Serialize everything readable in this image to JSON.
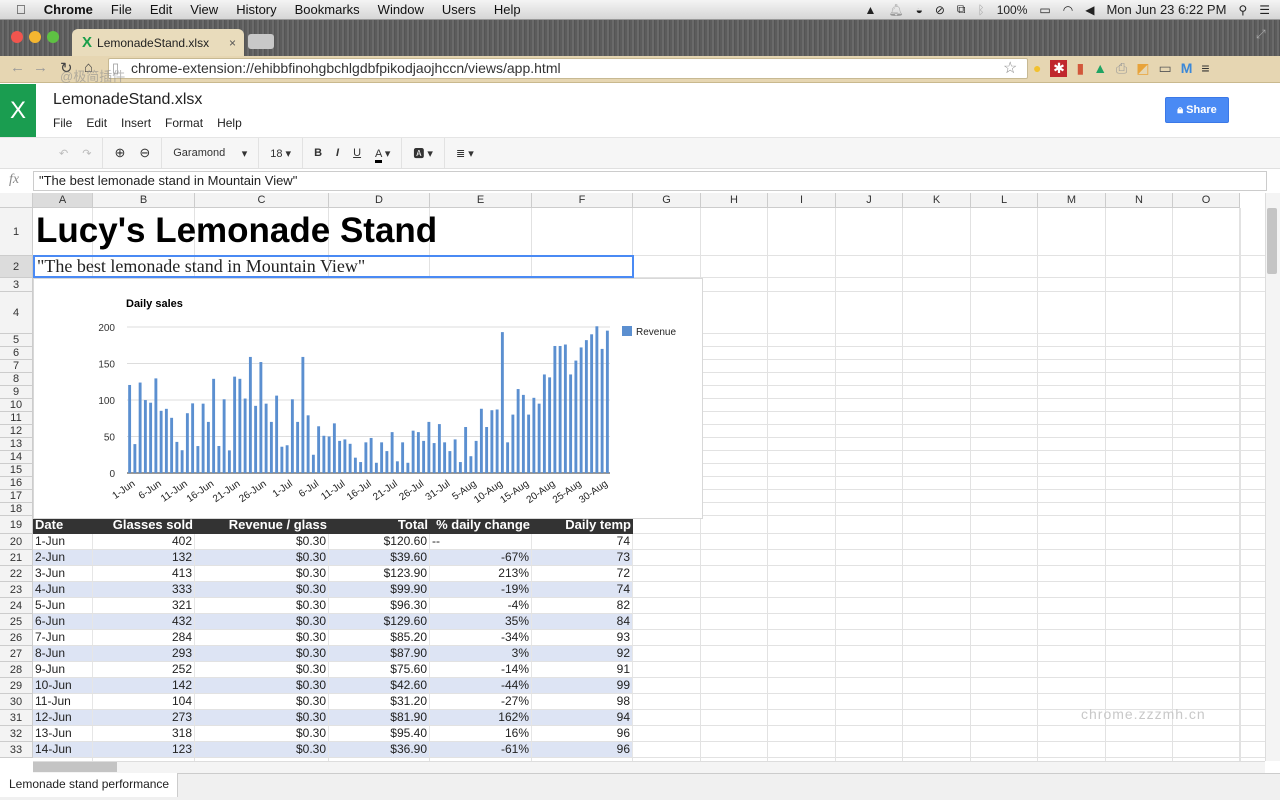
{
  "os_menubar": {
    "app": "Chrome",
    "items": [
      "File",
      "Edit",
      "View",
      "History",
      "Bookmarks",
      "Window",
      "Users",
      "Help"
    ],
    "battery": "100%",
    "clock": "Mon Jun 23  6:22 PM"
  },
  "browser": {
    "tab_title": "LemonadeStand.xlsx",
    "url": "chrome-extension://ehibbfinohgbchlgdbfpikodjaojhccn/views/app.html",
    "watermark_overlay": "@极简插件"
  },
  "app": {
    "logo": "X",
    "doc_title": "LemonadeStand.xlsx",
    "menu": [
      "File",
      "Edit",
      "Insert",
      "Format",
      "Help"
    ],
    "share_label": "Share",
    "toolbar": {
      "font": "Garamond",
      "size": "18",
      "bold": "B",
      "italic": "I",
      "underline": "U",
      "text_color": "A"
    },
    "formula_icon": "fx",
    "formula_value": "\"The best lemonade stand in Mountain View\""
  },
  "sheet": {
    "columns": [
      "A",
      "B",
      "C",
      "D",
      "E",
      "F",
      "G",
      "H",
      "I",
      "J",
      "K",
      "L",
      "M",
      "N",
      "O"
    ],
    "title": "Lucy's Lemonade Stand",
    "subtitle": "\"The best lemonade stand in Mountain View\"",
    "table_headers": [
      "Date",
      "Glasses sold",
      "Revenue / glass",
      "Total",
      "% daily change",
      "Daily temp"
    ],
    "table_rows": [
      [
        "1-Jun",
        "402",
        "$0.30",
        "$120.60",
        "--",
        "74"
      ],
      [
        "2-Jun",
        "132",
        "$0.30",
        "$39.60",
        "-67%",
        "73"
      ],
      [
        "3-Jun",
        "413",
        "$0.30",
        "$123.90",
        "213%",
        "72"
      ],
      [
        "4-Jun",
        "333",
        "$0.30",
        "$99.90",
        "-19%",
        "74"
      ],
      [
        "5-Jun",
        "321",
        "$0.30",
        "$96.30",
        "-4%",
        "82"
      ],
      [
        "6-Jun",
        "432",
        "$0.30",
        "$129.60",
        "35%",
        "84"
      ],
      [
        "7-Jun",
        "284",
        "$0.30",
        "$85.20",
        "-34%",
        "93"
      ],
      [
        "8-Jun",
        "293",
        "$0.30",
        "$87.90",
        "3%",
        "92"
      ],
      [
        "9-Jun",
        "252",
        "$0.30",
        "$75.60",
        "-14%",
        "91"
      ],
      [
        "10-Jun",
        "142",
        "$0.30",
        "$42.60",
        "-44%",
        "99"
      ],
      [
        "11-Jun",
        "104",
        "$0.30",
        "$31.20",
        "-27%",
        "98"
      ],
      [
        "12-Jun",
        "273",
        "$0.30",
        "$81.90",
        "162%",
        "94"
      ],
      [
        "13-Jun",
        "318",
        "$0.30",
        "$95.40",
        "16%",
        "96"
      ],
      [
        "14-Jun",
        "123",
        "$0.30",
        "$36.90",
        "-61%",
        "96"
      ]
    ],
    "sheet_tab": "Lemonade stand performance",
    "header_color": "#333333",
    "band_color": "#dde4f4"
  },
  "watermark": "chrome.zzzmh.cn",
  "chart_data": {
    "type": "bar",
    "title": "Daily sales",
    "legend": "Revenue",
    "legend_position": "right",
    "color": "#5b8fd0",
    "ylim": [
      0,
      200
    ],
    "yticks": [
      0,
      50,
      100,
      150,
      200
    ],
    "grid": true,
    "start_date": "1-Jun",
    "xtick_labels": [
      "1-Jun",
      "6-Jun",
      "11-Jun",
      "16-Jun",
      "21-Jun",
      "26-Jun",
      "1-Jul",
      "6-Jul",
      "11-Jul",
      "16-Jul",
      "21-Jul",
      "26-Jul",
      "31-Jul",
      "5-Aug",
      "10-Aug",
      "15-Aug",
      "20-Aug",
      "25-Aug",
      "30-Aug"
    ],
    "values": [
      120.6,
      39.6,
      123.9,
      99.9,
      96.3,
      129.6,
      85.2,
      87.9,
      75.6,
      42.6,
      31.2,
      81.9,
      95.4,
      36.9,
      95,
      70,
      129,
      37,
      101,
      31,
      132,
      129,
      102,
      159,
      92,
      152,
      95,
      70,
      106,
      36,
      38,
      101,
      70,
      159,
      79,
      25,
      64,
      51,
      50,
      68,
      44,
      46,
      40,
      21,
      15,
      42,
      48,
      14,
      42,
      30,
      56,
      16,
      42,
      14,
      58,
      56,
      44,
      70,
      41,
      67,
      42,
      30,
      46,
      15,
      63,
      23,
      44,
      88,
      63,
      86,
      87,
      193,
      42,
      80,
      115,
      107,
      80,
      103,
      95,
      135,
      131,
      174,
      174,
      176,
      135,
      154,
      172,
      182,
      190,
      201,
      170,
      195
    ]
  }
}
